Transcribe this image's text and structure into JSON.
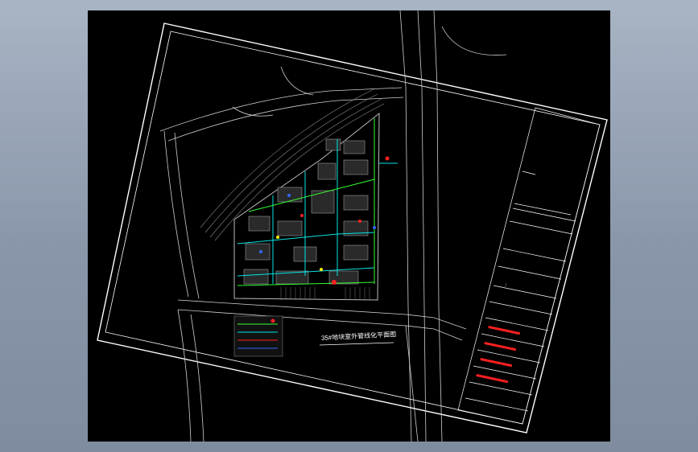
{
  "drawing": {
    "title": "35#地块室外管线化平面图",
    "title_block_rows": [
      "",
      "",
      "",
      "",
      "",
      "",
      "",
      "",
      "",
      "",
      ""
    ],
    "colors": {
      "background": "#000000",
      "frame": "#ffffff",
      "road": "#cfcfcf",
      "pipe_cyan": "#00e5e5",
      "pipe_green": "#33ff33",
      "marker_red": "#ff2020",
      "marker_blue": "#3366ff",
      "marker_yellow": "#ffee00",
      "building": "#9a9a9a"
    }
  }
}
